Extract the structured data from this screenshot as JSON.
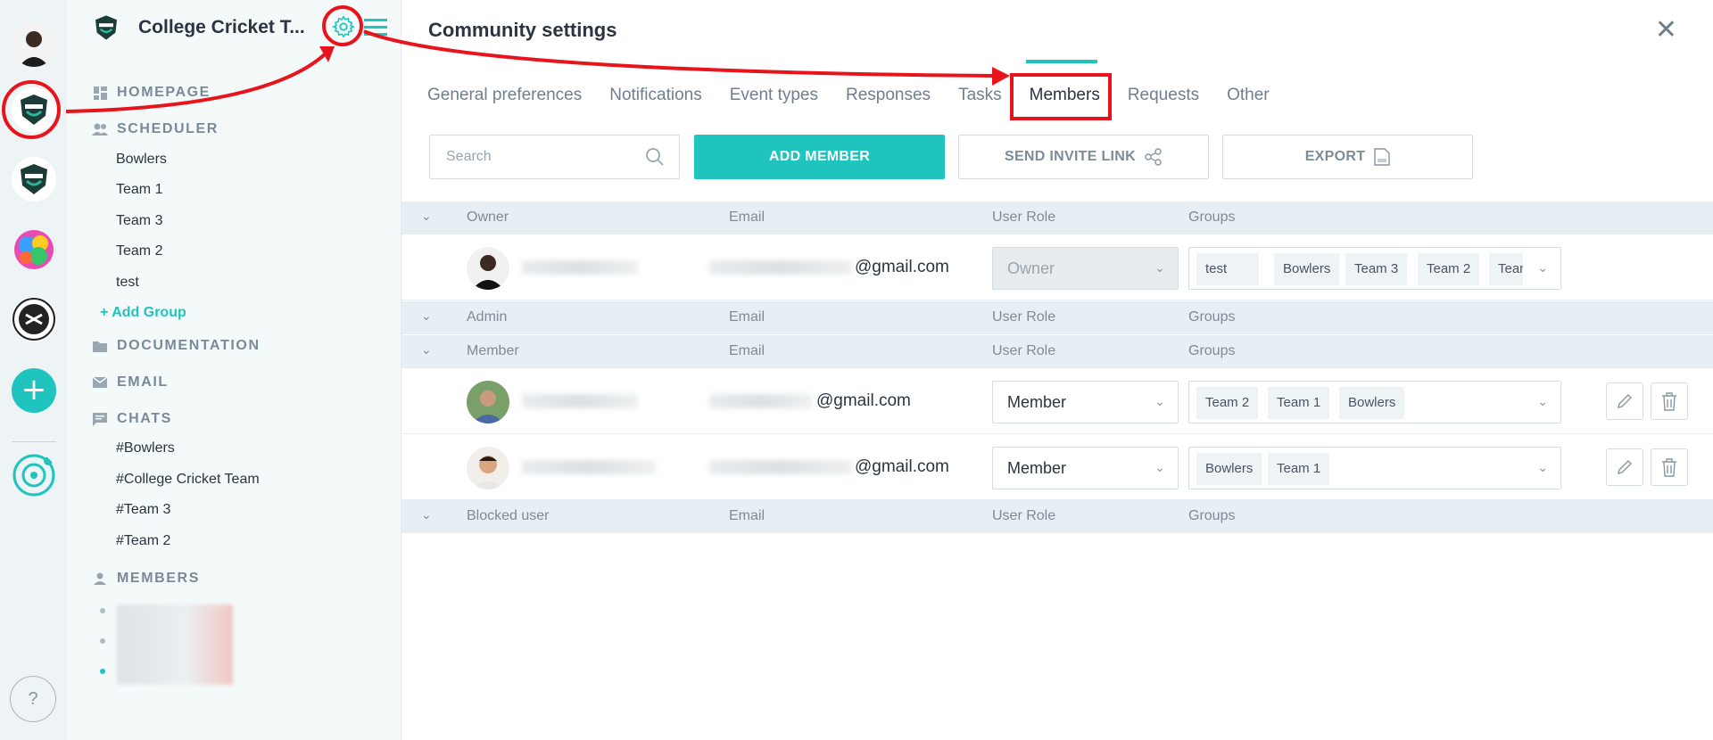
{
  "sidebar": {
    "title": "College Cricket T...",
    "sections": {
      "homepage": "HOMEPAGE",
      "scheduler": "SCHEDULER",
      "documentation": "DOCUMENTATION",
      "email": "EMAIL",
      "chats": "CHATS",
      "members": "MEMBERS"
    },
    "groups": [
      "Bowlers",
      "Team 1",
      "Team 3",
      "Team 2",
      "test"
    ],
    "add_group": "+ Add Group",
    "chats": [
      "#Bowlers",
      "#College Cricket Team",
      "#Team 3",
      "#Team 2"
    ]
  },
  "rail": {
    "help": "?",
    "add": "+"
  },
  "page": {
    "title": "Community settings",
    "close": "✕",
    "tabs": [
      "General preferences",
      "Notifications",
      "Event types",
      "Responses",
      "Tasks",
      "Members",
      "Requests",
      "Other"
    ],
    "active_tab": "Members"
  },
  "toolbar": {
    "search_placeholder": "Search",
    "add_member": "ADD MEMBER",
    "send_invite": "SEND INVITE LINK",
    "export": "EXPORT"
  },
  "table": {
    "owner_hdr": {
      "col1": "Owner",
      "email": "Email",
      "role": "User Role",
      "groups": "Groups"
    },
    "admin_hdr": {
      "col1": "Admin",
      "email": "Email",
      "role": "User Role",
      "groups": "Groups"
    },
    "member_hdr": {
      "col1": "Member",
      "email": "Email",
      "role": "User Role",
      "groups": "Groups"
    },
    "blocked_hdr": {
      "col1": "Blocked user",
      "email": "Email",
      "role": "User Role",
      "groups": "Groups"
    },
    "owner_row": {
      "email": "@gmail.com",
      "role": "Owner",
      "groups": [
        "test",
        "Bowlers",
        "Team 3",
        "Team 2",
        "Tean"
      ]
    },
    "member_rows": [
      {
        "email": "@gmail.com",
        "role": "Member",
        "groups": [
          "Team 2",
          "Team 1",
          "Bowlers"
        ]
      },
      {
        "email": "@gmail.com",
        "role": "Member",
        "groups": [
          "Bowlers",
          "Team 1"
        ]
      }
    ]
  },
  "colors": {
    "accent": "#1fc4bf",
    "annotation": "#e8141c"
  }
}
